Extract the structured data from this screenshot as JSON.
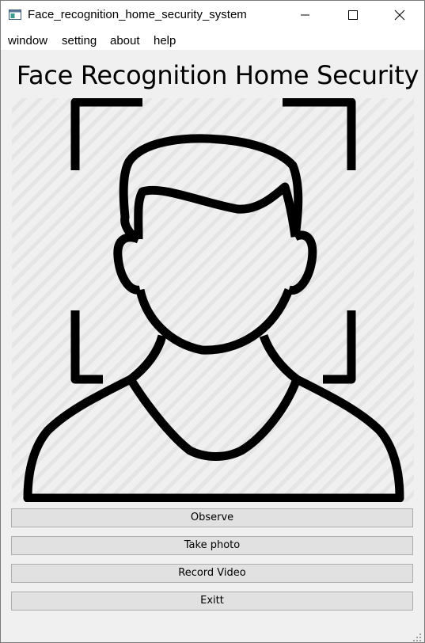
{
  "window": {
    "title": "Face_recognition_home_security_system",
    "icon": "app-window-icon",
    "controls": [
      "minimize-icon",
      "maximize-icon",
      "close-icon"
    ]
  },
  "menu": {
    "items": [
      "window",
      "setting",
      "about",
      "help"
    ]
  },
  "main": {
    "heading": "Face Recognition Home Security",
    "image": "face-scan-icon"
  },
  "buttons": {
    "observe": "Observe",
    "take_photo": "Take photo",
    "record_video": "Record Video",
    "exit": "Exitt"
  },
  "colors": {
    "background": "#f0f0f0",
    "button_bg": "#e1e1e1",
    "button_border": "#adadad",
    "icon_stroke": "#000000"
  }
}
